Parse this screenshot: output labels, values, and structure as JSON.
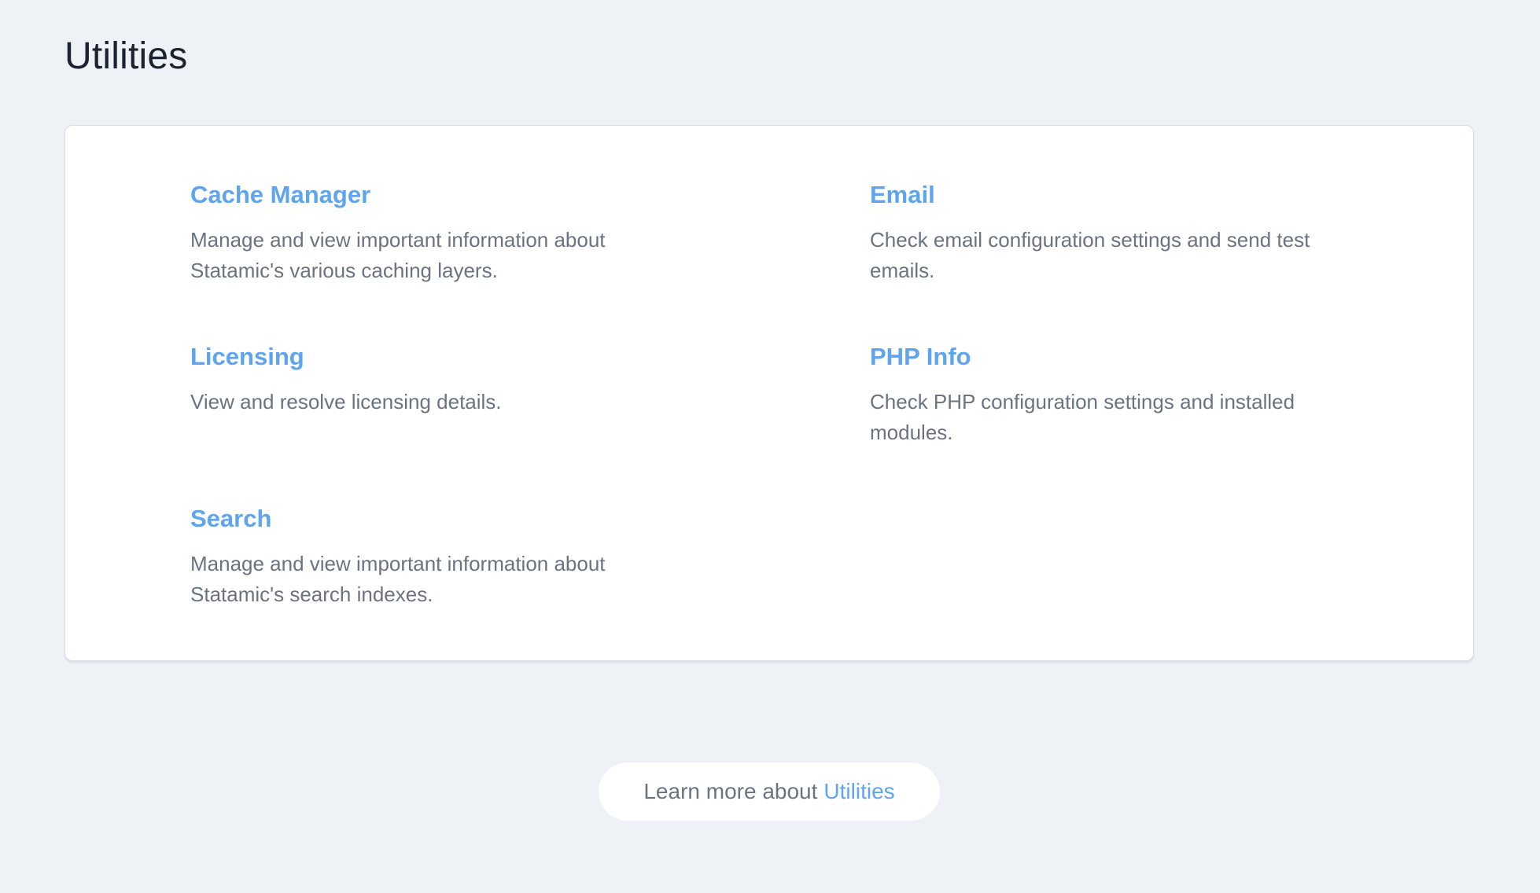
{
  "page": {
    "title": "Utilities"
  },
  "utilities": [
    {
      "title": "Cache Manager",
      "description_line1": "Manage and view important information about",
      "description_line2": "Statamic's various caching layers."
    },
    {
      "title": "Email",
      "description_line1": "Check email configuration settings and send test",
      "description_line2": "emails."
    },
    {
      "title": "Licensing",
      "description_line1": "View and resolve licensing details.",
      "description_line2": ""
    },
    {
      "title": "PHP Info",
      "description_line1": "Check PHP configuration settings and installed",
      "description_line2": "modules."
    },
    {
      "title": "Search",
      "description_line1": "Manage and view important information about",
      "description_line2": "Statamic's search indexes."
    }
  ],
  "footer": {
    "learn_more_prefix": "Learn more about",
    "learn_more_link": "Utilities"
  },
  "colors": {
    "accent": "#5ea5ee",
    "background": "#eef2f7",
    "card": "#ffffff",
    "muted_text": "#6b7380",
    "heading_text": "#1c2330"
  }
}
